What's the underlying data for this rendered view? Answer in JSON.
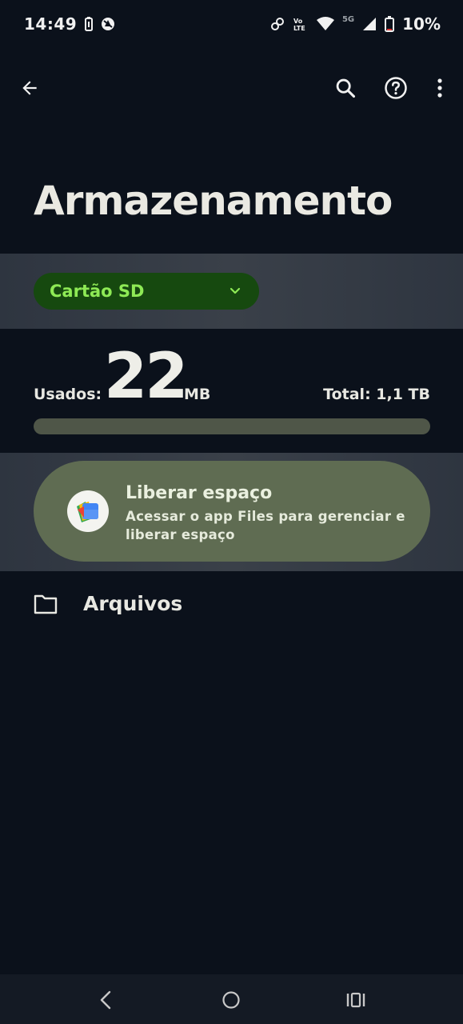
{
  "status_bar": {
    "time": "14:49",
    "battery_percent": "10%",
    "icons": [
      "battery-saver-icon",
      "app-notification-icon",
      "link-icon",
      "volte-icon",
      "wifi-icon",
      "5g-icon",
      "signal-icon",
      "battery-icon"
    ],
    "network_label": "5G",
    "volte_label": "Vo LTE"
  },
  "toolbar": {
    "back_icon": "arrow-left-icon",
    "search_icon": "search-icon",
    "help_icon": "help-circle-icon",
    "more_icon": "more-vertical-icon"
  },
  "page": {
    "title": "Armazenamento"
  },
  "volume_selector": {
    "selected": "Cartão SD",
    "icon": "chevron-down-icon"
  },
  "usage": {
    "used_label": "Usados:",
    "used_value": "22",
    "used_unit": "MB",
    "total_label": "Total: 1,1 TB",
    "fraction_used": 0.0
  },
  "free_space_card": {
    "title": "Liberar espaço",
    "subtitle": "Acessar o app Files para gerenciar e liberar espaço",
    "icon": "files-app-icon"
  },
  "files_entry": {
    "label": "Arquivos",
    "icon": "folder-icon"
  },
  "nav_bar": {
    "back": "nav-back-icon",
    "home": "nav-home-icon",
    "recents": "nav-recents-icon"
  },
  "colors": {
    "background": "#0b111b",
    "accent_green": "#8eea55",
    "dropdown_bg": "#16490f",
    "card_bg": "#5f6c52",
    "track_bg": "#4f5648"
  }
}
